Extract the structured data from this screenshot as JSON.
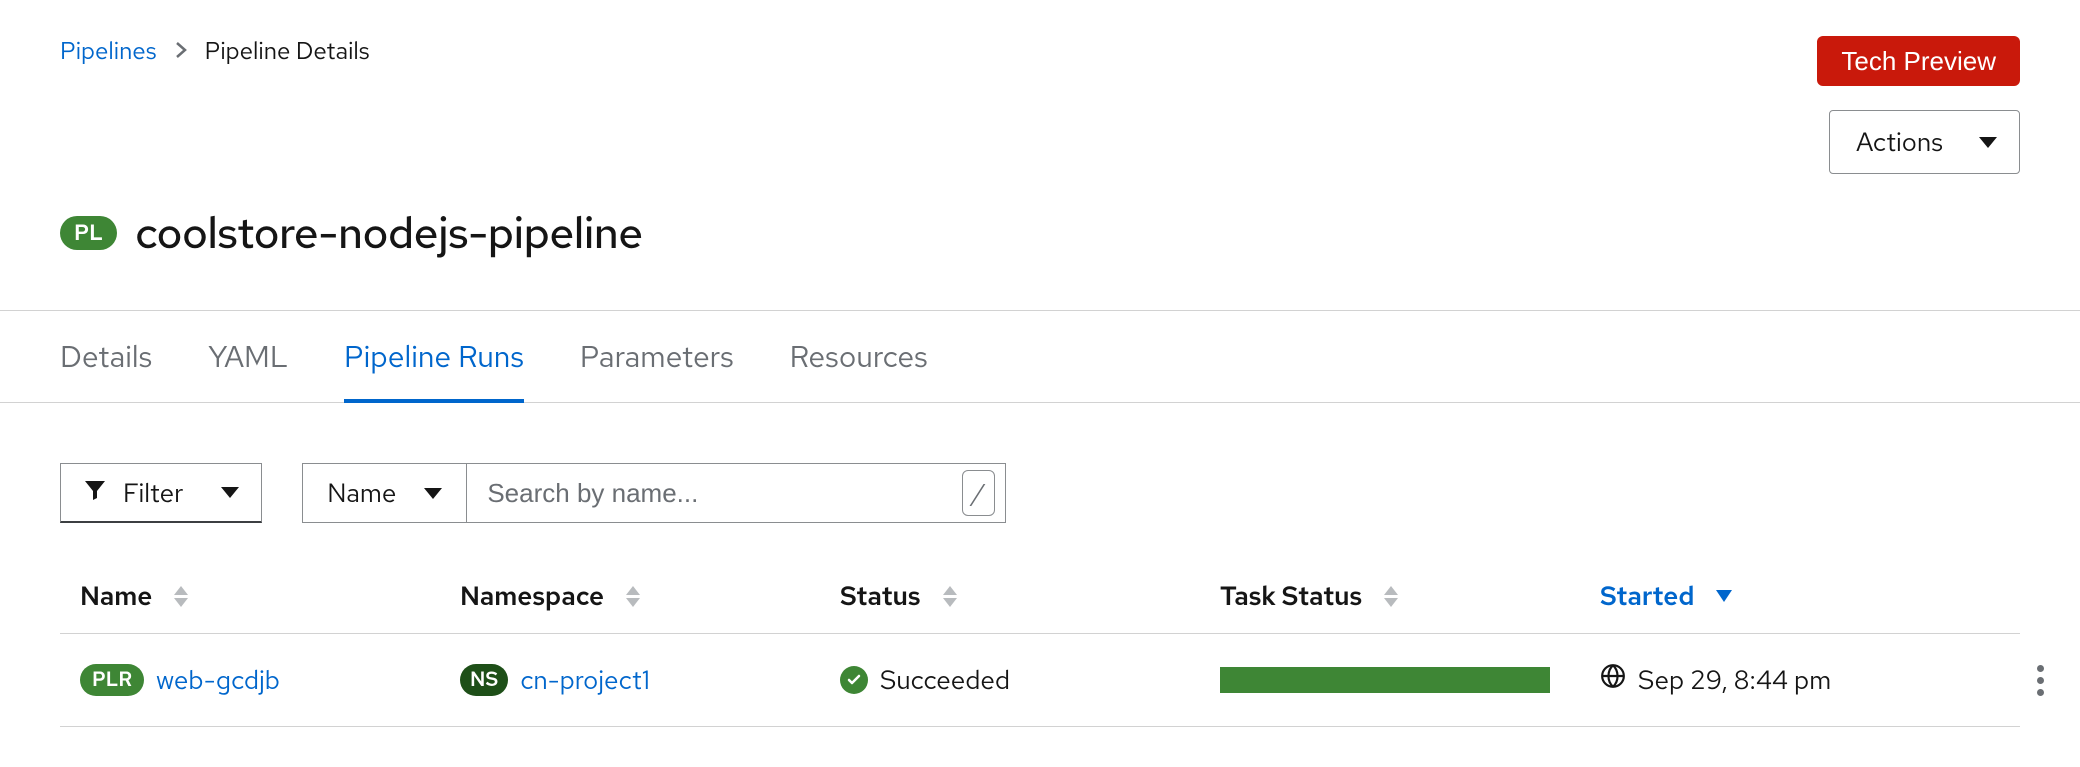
{
  "breadcrumb": {
    "root": "Pipelines",
    "current": "Pipeline Details"
  },
  "header": {
    "tech_preview": "Tech Preview",
    "actions": "Actions",
    "title_badge": "PL",
    "title": "coolstore-nodejs-pipeline"
  },
  "tabs": {
    "items": [
      "Details",
      "YAML",
      "Pipeline Runs",
      "Parameters",
      "Resources"
    ],
    "active_index": 2
  },
  "toolbar": {
    "filter_label": "Filter",
    "name_label": "Name",
    "search_placeholder": "Search by name...",
    "shortcut_hint": "/"
  },
  "table": {
    "columns": {
      "name": "Name",
      "namespace": "Namespace",
      "status": "Status",
      "task_status": "Task Status",
      "started": "Started"
    },
    "sort": {
      "column": "started",
      "direction": "desc"
    },
    "rows": [
      {
        "name_badge": "PLR",
        "name": "web-gcdjb",
        "ns_badge": "NS",
        "namespace": "cn-project1",
        "status": "Succeeded",
        "task_progress_pct": 100,
        "started": "Sep 29, 8:44 pm"
      }
    ]
  }
}
